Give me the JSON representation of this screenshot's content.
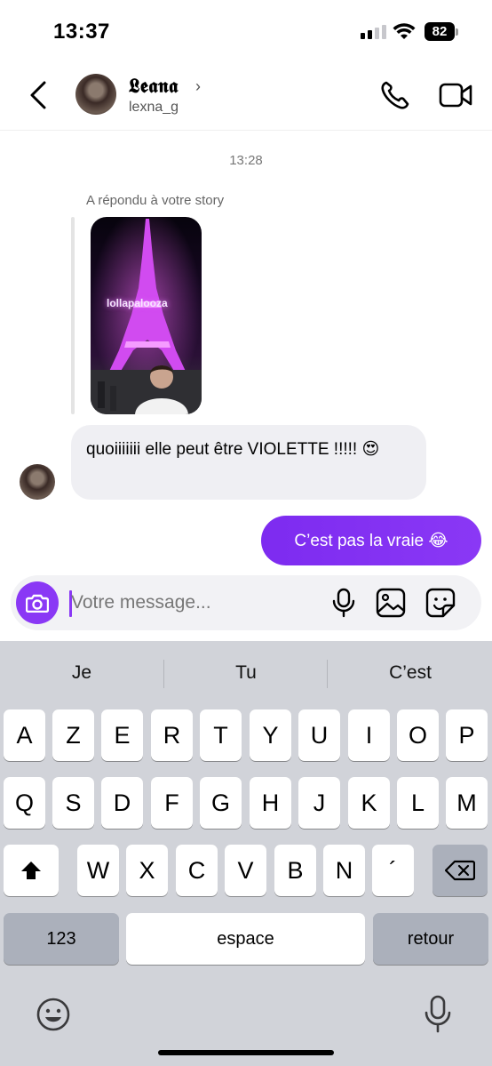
{
  "status_bar": {
    "time": "13:37",
    "battery": "82"
  },
  "header": {
    "name": "𝕷𝖊𝖆𝖓𝖆",
    "chevron": "›",
    "username": "lexna_g"
  },
  "conversation": {
    "timestamp": "13:28",
    "reply_label": "A répondu à votre story",
    "story_logo": "lollapalooza",
    "incoming_message": "quoiiiiiii elle peut être VIOLETTE !!!!! 😍",
    "outgoing_message": "C’est pas la vraie 😂"
  },
  "composer": {
    "placeholder": "Votre message..."
  },
  "keyboard": {
    "suggestions": [
      "Je",
      "Tu",
      "C’est"
    ],
    "row1": [
      "A",
      "Z",
      "E",
      "R",
      "T",
      "Y",
      "U",
      "I",
      "O",
      "P"
    ],
    "row2": [
      "Q",
      "S",
      "D",
      "F",
      "G",
      "H",
      "J",
      "K",
      "L",
      "M"
    ],
    "row3": [
      "W",
      "X",
      "C",
      "V",
      "B",
      "N",
      "´"
    ],
    "numbers_key": "123",
    "space_key": "espace",
    "return_key": "retour"
  },
  "colors": {
    "accent": "#8a38f5",
    "keyboard_bg": "#d1d3d9"
  }
}
